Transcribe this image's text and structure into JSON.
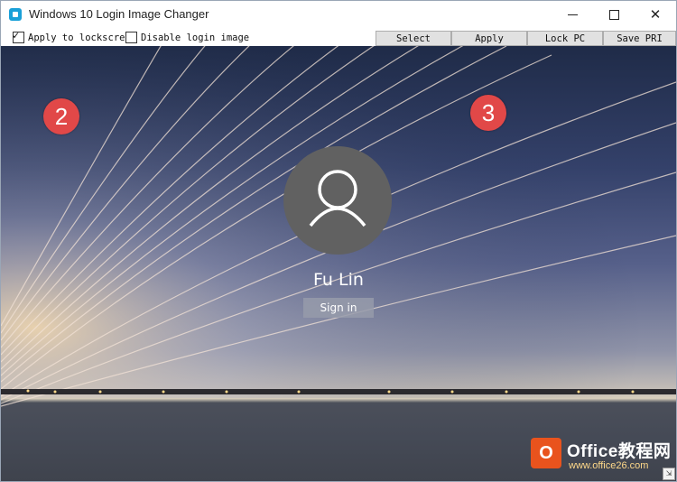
{
  "window": {
    "title": "Windows 10 Login Image Changer",
    "icon": "app-icon",
    "controls": {
      "minimize": "—",
      "maximize": "☐",
      "close": "✕"
    }
  },
  "toolbar": {
    "apply_lockscreen": {
      "label": "Apply to lockscreen",
      "checked": true
    },
    "disable_login_image": {
      "label": "Disable login image",
      "checked": false
    },
    "buttons": {
      "select": "Select",
      "apply": "Apply",
      "lock_pc": "Lock PC",
      "save_pri": "Save PRI"
    }
  },
  "annotations": {
    "step_2": "2",
    "step_3": "3",
    "color": "#e14848"
  },
  "preview": {
    "user_name": "Fu Lin",
    "sign_in_label": "Sign in"
  },
  "watermark": {
    "logo_glyph": "O",
    "title": "Office教程网",
    "subtitle": "www.office26.com"
  }
}
